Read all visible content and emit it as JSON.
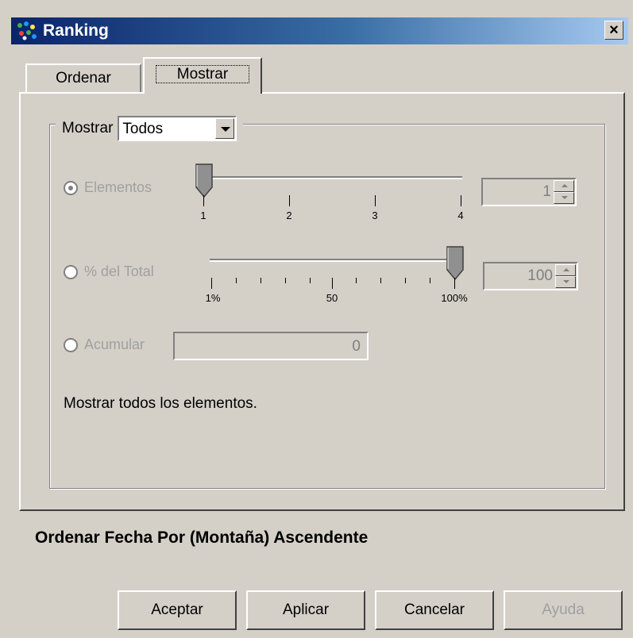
{
  "window": {
    "title": "Ranking",
    "close_symbol": "×"
  },
  "tabs": [
    {
      "label": "Ordenar"
    },
    {
      "label": "Mostrar"
    }
  ],
  "mostrar_group": {
    "label": "Mostrar",
    "combo_value": "Todos"
  },
  "elementos": {
    "label": "Elementos",
    "selected": true,
    "slider_ticks": [
      "1",
      "2",
      "3",
      "4"
    ],
    "slider_value": 1,
    "spin_value": "1"
  },
  "porcentaje": {
    "label": "% del Total",
    "selected": false,
    "slider_ticks": [
      "1%",
      "50",
      "100%"
    ],
    "slider_value": 100,
    "spin_value": "100"
  },
  "acumular": {
    "label": "Acumular",
    "selected": false,
    "value": "0"
  },
  "description": "Mostrar todos los elementos.",
  "summary": "Ordenar Fecha Por  (Montaña)  Ascendente",
  "buttons": {
    "accept": "Aceptar",
    "apply": "Aplicar",
    "cancel": "Cancelar",
    "help": "Ayuda"
  }
}
